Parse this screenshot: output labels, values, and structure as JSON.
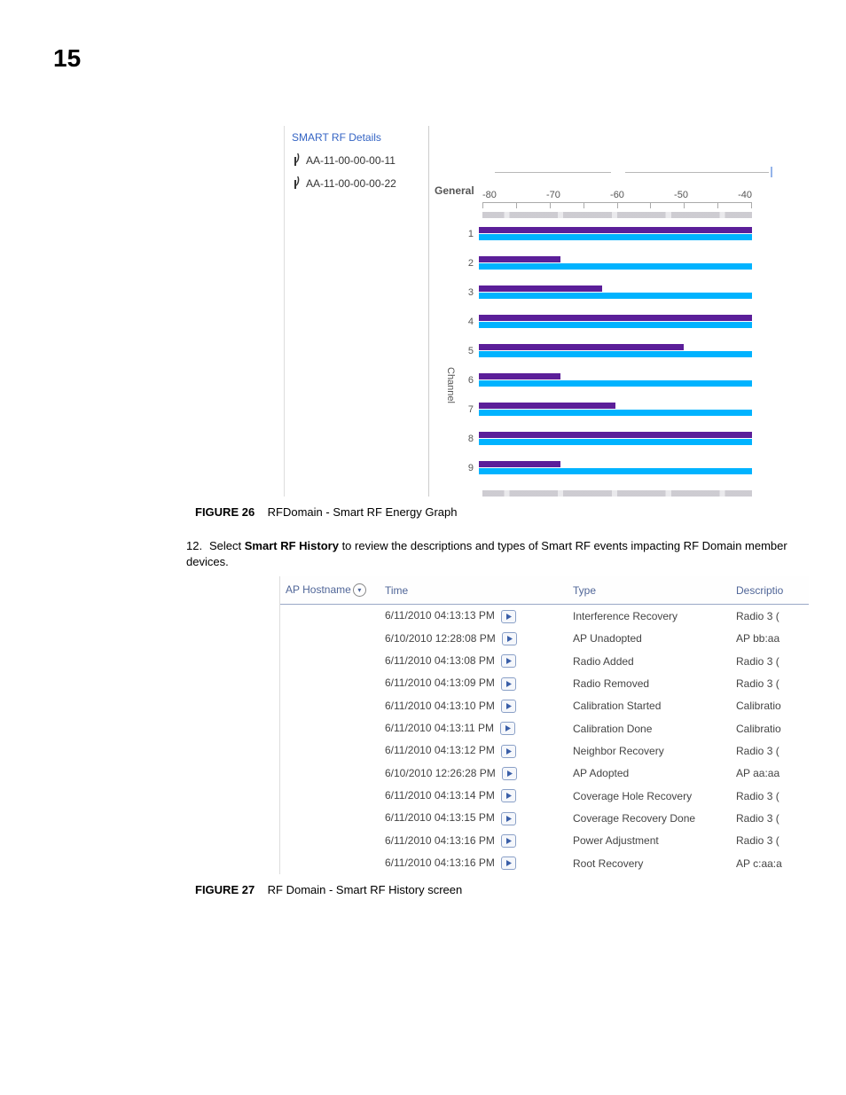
{
  "page": {
    "chapter": "15"
  },
  "fig26": {
    "tree_header": "SMART RF Details",
    "tree_items": [
      "AA-11-00-00-00-11",
      "AA-11-00-00-00-22"
    ],
    "general_label": "General",
    "y_label": "Channel",
    "x_ticks": [
      "-80",
      "-70",
      "-60",
      "-50",
      "-40"
    ]
  },
  "chart_data": {
    "type": "bar",
    "orientation": "horizontal",
    "title": "",
    "xlabel": "",
    "x_ticks": [
      -80,
      -70,
      -60,
      -50,
      -40
    ],
    "ylabel": "Channel",
    "categories": [
      "1",
      "2",
      "3",
      "4",
      "5",
      "6",
      "7",
      "8",
      "9"
    ],
    "series": [
      {
        "name": "AA-11-00-00-00-11",
        "color": "#5b1e99",
        "values": [
          -40,
          -68,
          -62,
          -40,
          -50,
          -68,
          -60,
          -40,
          -68
        ]
      },
      {
        "name": "AA-11-00-00-00-22",
        "color": "#00b3ff",
        "values": [
          -40,
          -40,
          -40,
          -40,
          -40,
          -40,
          -40,
          -40,
          -40
        ]
      }
    ],
    "xlim": [
      -80,
      -40
    ],
    "grid": false
  },
  "caption26": {
    "label": "FIGURE 26",
    "text": "RFDomain - Smart RF Energy Graph"
  },
  "step12": {
    "num": "12.",
    "prefix": "Select ",
    "bold": "Smart RF History",
    "rest": " to review the descriptions and types of Smart RF events impacting RF Domain member devices."
  },
  "fig27": {
    "headers": {
      "host": "AP Hostname",
      "time": "Time",
      "type": "Type",
      "desc": "Descriptio"
    },
    "rows": [
      {
        "time": "6/11/2010 04:13:13 PM",
        "type": "Interference Recovery",
        "desc": "Radio 3 ("
      },
      {
        "time": "6/10/2010 12:28:08 PM",
        "type": "AP Unadopted",
        "desc": "AP bb:aa"
      },
      {
        "time": "6/11/2010 04:13:08 PM",
        "type": "Radio Added",
        "desc": "Radio 3 ("
      },
      {
        "time": "6/11/2010 04:13:09 PM",
        "type": "Radio Removed",
        "desc": "Radio 3 ("
      },
      {
        "time": "6/11/2010 04:13:10 PM",
        "type": "Calibration Started",
        "desc": "Calibratio"
      },
      {
        "time": "6/11/2010 04:13:11 PM",
        "type": "Calibration Done",
        "desc": "Calibratio"
      },
      {
        "time": "6/11/2010 04:13:12 PM",
        "type": "Neighbor Recovery",
        "desc": "Radio 3 ("
      },
      {
        "time": "6/10/2010 12:26:28 PM",
        "type": "AP Adopted",
        "desc": "AP aa:aa"
      },
      {
        "time": "6/11/2010 04:13:14 PM",
        "type": "Coverage Hole Recovery",
        "desc": "Radio 3 ("
      },
      {
        "time": "6/11/2010 04:13:15 PM",
        "type": "Coverage Recovery Done",
        "desc": "Radio 3 ("
      },
      {
        "time": "6/11/2010 04:13:16 PM",
        "type": "Power Adjustment",
        "desc": "Radio 3 ("
      },
      {
        "time": "6/11/2010 04:13:16 PM",
        "type": "Root Recovery",
        "desc": "AP c:aa:a"
      }
    ]
  },
  "caption27": {
    "label": "FIGURE 27",
    "text": "RF Domain - Smart RF History screen"
  }
}
